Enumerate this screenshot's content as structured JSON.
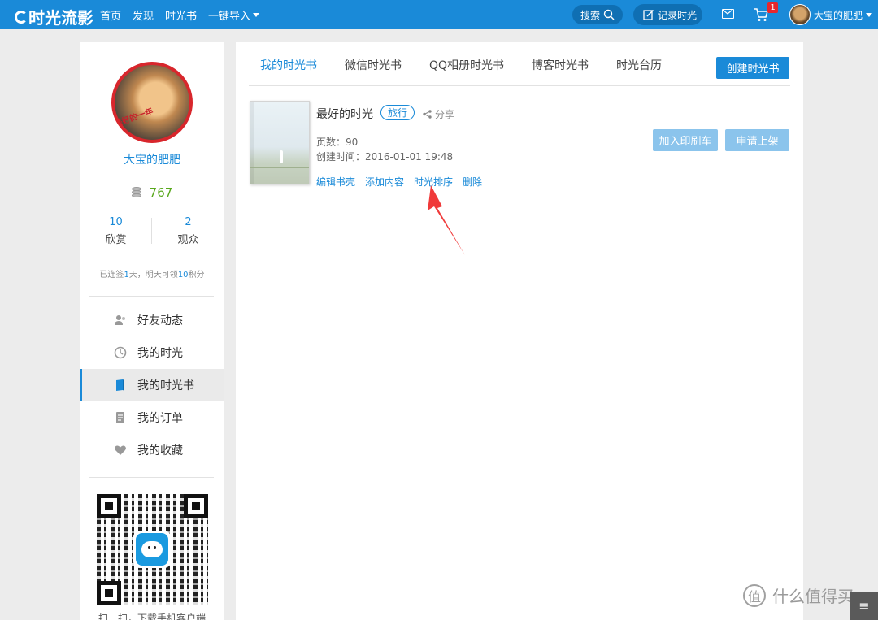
{
  "topbar": {
    "logo": "时光流影",
    "nav": [
      "首页",
      "发现",
      "时光书",
      "一键导入"
    ],
    "search_label": "搜索",
    "record_label": "记录时光",
    "cart_badge": "1",
    "username": "大宝的肥肥",
    "colors": {
      "bar": "#1a8ad8",
      "badge": "#e8262c"
    },
    "icons": [
      "search-icon",
      "edit-icon",
      "mail-icon",
      "cart-icon",
      "avatar",
      "chevron-down-icon"
    ]
  },
  "profile": {
    "avatar_stamp": "美好的一年",
    "name": "大宝的肥肥",
    "coins": "767",
    "stats": [
      {
        "value": "10",
        "label": "欣赏"
      },
      {
        "value": "2",
        "label": "观众"
      }
    ],
    "checkin": {
      "pre": "已连签",
      "days": "1",
      "mid": "天，明天可领",
      "points": "10",
      "post": "积分"
    }
  },
  "menu": [
    {
      "label": "好友动态",
      "icon": "friends-icon",
      "active": false
    },
    {
      "label": "我的时光",
      "icon": "clock-icon",
      "active": false
    },
    {
      "label": "我的时光书",
      "icon": "book-icon",
      "active": true
    },
    {
      "label": "我的订单",
      "icon": "order-icon",
      "active": false
    },
    {
      "label": "我的收藏",
      "icon": "heart-icon",
      "active": false
    }
  ],
  "qr": {
    "caption": "扫一扫，下载手机客户端"
  },
  "tabs": [
    "我的时光书",
    "微信时光书",
    "QQ相册时光书",
    "博客时光书",
    "时光台历"
  ],
  "create_button": "创建时光书",
  "book": {
    "title": "最好的时光",
    "tag": "旅行",
    "share": "分享",
    "pages": "页数：90",
    "created": "创建时间：2016-01-01 19:48",
    "actions": [
      "编辑书壳",
      "添加内容",
      "时光排序",
      "删除"
    ],
    "print_button": "加入印刷车",
    "shelf_button": "申请上架"
  },
  "watermark": {
    "glyph": "值",
    "text": "什么值得买"
  }
}
